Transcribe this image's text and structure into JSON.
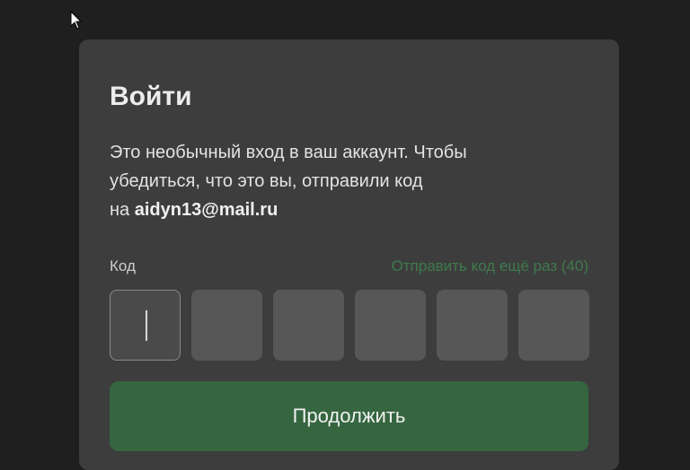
{
  "login": {
    "title": "Войти",
    "description_line1": "Это необычный вход в ваш аккаунт. Чтобы",
    "description_line2": "убедиться, что это вы, отправили код",
    "description_prefix": "на ",
    "email": "aidyn13@mail.ru",
    "code_label": "Код",
    "resend_label": "Отправить код ещё раз (40)",
    "code_digits": [
      "",
      "",
      "",
      "",
      "",
      ""
    ],
    "continue_label": "Продолжить"
  },
  "colors": {
    "background": "#1f1f1f",
    "card": "#3d3d3d",
    "accent_green": "#356640",
    "link_green": "#3f7a4c"
  },
  "icons": {
    "cursor": "mouse-pointer-icon"
  }
}
